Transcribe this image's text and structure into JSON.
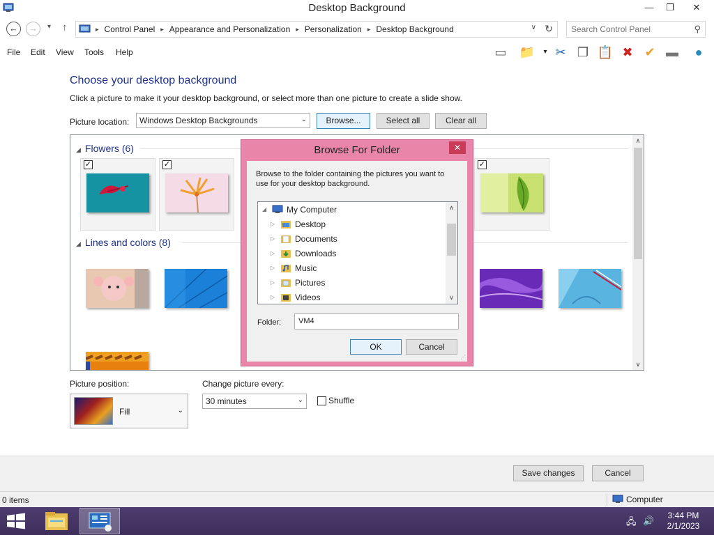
{
  "window": {
    "title": "Desktop Background",
    "min_glyph": "—",
    "restore_glyph": "❐",
    "close_glyph": "✕"
  },
  "nav": {
    "back_glyph": "←",
    "forward_glyph": "→",
    "history_glyph": "▾",
    "up_glyph": "↑",
    "breadcrumbs": [
      "Control Panel",
      "Appearance and Personalization",
      "Personalization",
      "Desktop Background"
    ],
    "crumb_separator": "▸",
    "dropdown_glyph": "∨",
    "refresh_glyph": "↻",
    "search_placeholder": "Search Control Panel",
    "search_glyph": "⚲"
  },
  "menu": [
    "File",
    "Edit",
    "View",
    "Tools",
    "Help"
  ],
  "toolbar_icons": [
    {
      "name": "layout-icon",
      "glyph": "▭",
      "color": "#666666"
    },
    {
      "name": "folder-options-icon",
      "glyph": "📁",
      "color": "#d6a92a"
    },
    {
      "name": "cut-icon",
      "glyph": "✂",
      "color": "#2a6cb5"
    },
    {
      "name": "copy-icon",
      "glyph": "❐",
      "color": "#555555"
    },
    {
      "name": "paste-icon",
      "glyph": "📋",
      "color": "#8a6a2a"
    },
    {
      "name": "delete-icon",
      "glyph": "✖",
      "color": "#d02020"
    },
    {
      "name": "checkmark-icon",
      "glyph": "✔",
      "color": "#f0a030"
    },
    {
      "name": "properties-icon",
      "glyph": "▬",
      "color": "#777777"
    },
    {
      "name": "globe-icon",
      "glyph": "●",
      "color": "#2a8ab8"
    }
  ],
  "main": {
    "heading": "Choose your desktop background",
    "instructions": "Click a picture to make it your desktop background, or select more than one picture to create a slide show.",
    "location_label": "Picture location:",
    "location_value": "Windows Desktop Backgrounds",
    "select_glyph": "⌄",
    "browse_label": "Browse...",
    "select_all_label": "Select all",
    "clear_all_label": "Clear all",
    "check_glyph": "✓",
    "expand_glyph": "◢",
    "groups": [
      {
        "label": "Flowers (6)"
      },
      {
        "label": "Lines and colors (8)"
      }
    ],
    "scroll_up_glyph": "∧",
    "scroll_down_glyph": "∨",
    "position_label": "Picture position:",
    "position_value": "Fill",
    "change_label": "Change picture every:",
    "change_value": "30 minutes",
    "shuffle_label": "Shuffle",
    "save_label": "Save changes",
    "cancel_label": "Cancel"
  },
  "status": {
    "items": "0 items",
    "zone": "Computer"
  },
  "taskbar": {
    "time": "3:44 PM",
    "date": "2/1/2023",
    "network_glyph": "🖧",
    "volume_glyph": "🔊"
  },
  "dialog": {
    "title": "Browse For Folder",
    "close_glyph": "✕",
    "description": "Browse to the folder containing the pictures you want to use for your desktop background.",
    "tree_expanded_glyph": "◢",
    "tree_collapsed_glyph": "▷",
    "tree": [
      {
        "label": "My Computer",
        "level": 0,
        "icon": "computer"
      },
      {
        "label": "Desktop",
        "level": 1,
        "icon": "desktop"
      },
      {
        "label": "Documents",
        "level": 1,
        "icon": "documents"
      },
      {
        "label": "Downloads",
        "level": 1,
        "icon": "downloads"
      },
      {
        "label": "Music",
        "level": 1,
        "icon": "music"
      },
      {
        "label": "Pictures",
        "level": 1,
        "icon": "pictures"
      },
      {
        "label": "Videos",
        "level": 1,
        "icon": "videos"
      }
    ],
    "folder_label": "Folder:",
    "folder_value": "VM4",
    "ok_label": "OK",
    "cancel_label": "Cancel",
    "grip_glyph": "⋰"
  },
  "colors": {
    "heading": "#1e3287",
    "dialog_frame": "#e985a8",
    "taskbar": "#4d3d6e",
    "close_red": "#c93b56"
  }
}
